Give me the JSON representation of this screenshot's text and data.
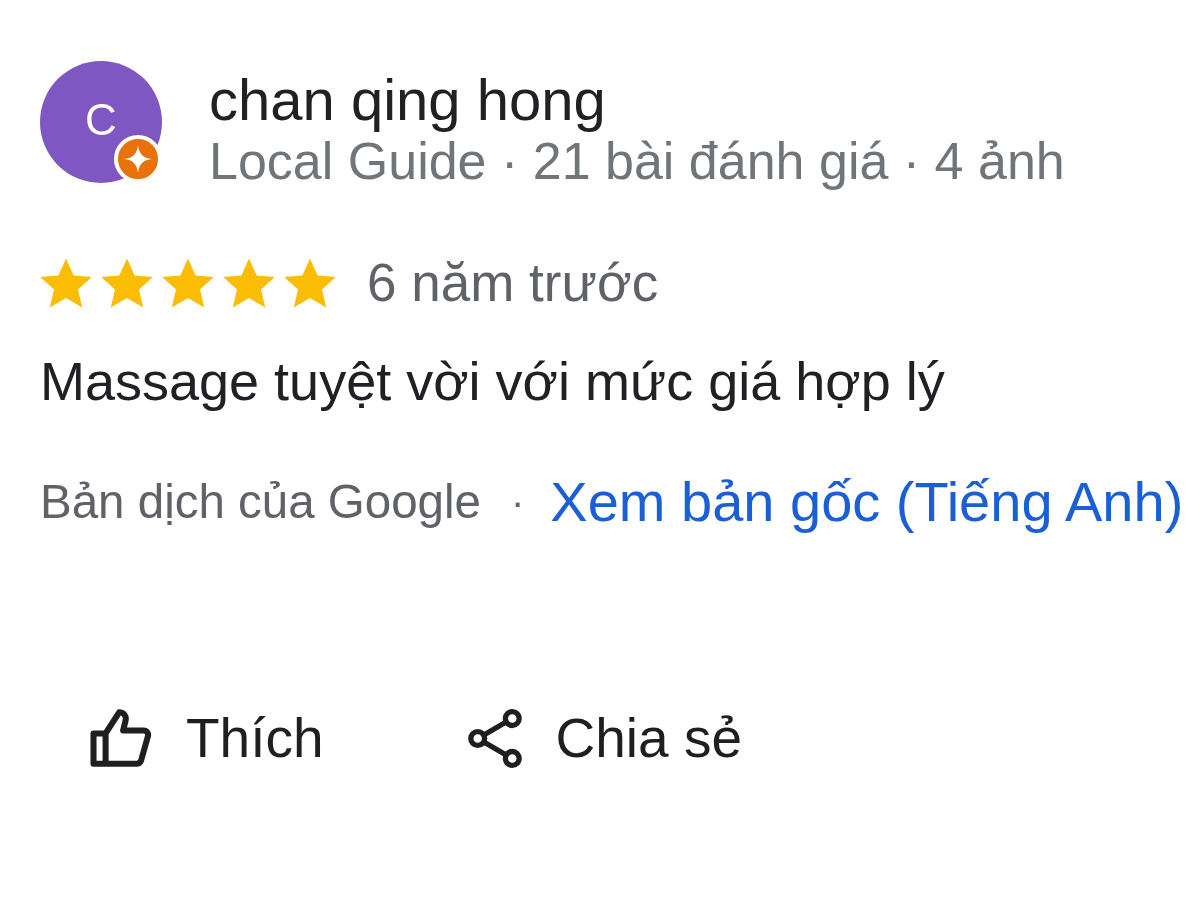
{
  "reviewer": {
    "initial": "C",
    "local_guide_badge": true,
    "name": "chan qing hong",
    "meta": "Local Guide · 21 bài đánh giá · 4 ảnh"
  },
  "rating": {
    "stars": 5,
    "time": "6 năm trước"
  },
  "review_text": "Massage tuyệt vời với mức giá hợp lý",
  "translation": {
    "label": "Bản dịch của Google",
    "separator": "·",
    "link": "Xem bản gốc (Tiếng Anh)"
  },
  "actions": [
    {
      "kind": "like",
      "label": "Thích"
    },
    {
      "kind": "share",
      "label": "Chia sẻ"
    }
  ]
}
